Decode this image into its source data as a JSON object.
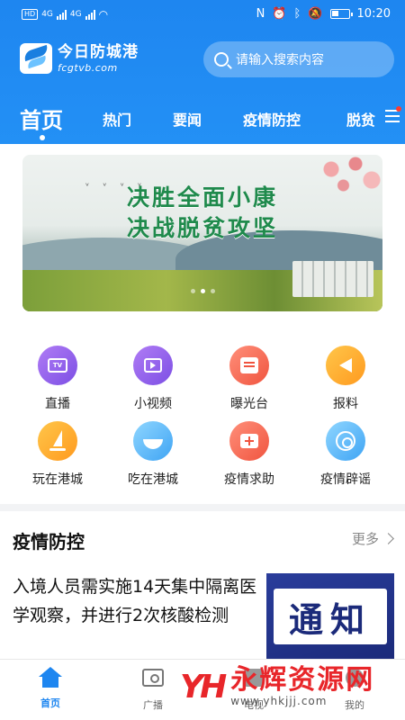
{
  "status_bar": {
    "left_badge": "HD",
    "network_a": "4G",
    "network_b": "4G",
    "time": "10:20"
  },
  "header": {
    "logo_cn": "今日防城港",
    "logo_en": "fcgtvb.com",
    "search_placeholder": "请输入搜索内容",
    "tabs": [
      {
        "label": "首页",
        "active": true
      },
      {
        "label": "热门"
      },
      {
        "label": "要闻"
      },
      {
        "label": "疫情防控"
      },
      {
        "label": "脱贫"
      }
    ]
  },
  "banner": {
    "line1": "决胜全面小康",
    "line2": "决战脱贫攻坚",
    "slide_count": 3,
    "current_slide": 2
  },
  "quick_entries": [
    {
      "label": "直播",
      "icon": "tv-icon",
      "color": "#8b5cf0"
    },
    {
      "label": "小视频",
      "icon": "video-icon",
      "color": "#8b5cf0"
    },
    {
      "label": "曝光台",
      "icon": "news-icon",
      "color": "#f0543f"
    },
    {
      "label": "报料",
      "icon": "megaphone-icon",
      "color": "#ff9a1f"
    },
    {
      "label": "玩在港城",
      "icon": "sailboat-icon",
      "color": "#ff9a1f"
    },
    {
      "label": "吃在港城",
      "icon": "bowl-icon",
      "color": "#3fa4f4"
    },
    {
      "label": "疫情求助",
      "icon": "medical-kit-icon",
      "color": "#f0543f"
    },
    {
      "label": "疫情辟谣",
      "icon": "target-icon",
      "color": "#3fa4f4"
    }
  ],
  "section": {
    "title": "疫情防控",
    "more": "更多",
    "article_title": "入境人员需实施14天集中隔离医学观察，并进行2次核酸检测",
    "thumb_text": "通知"
  },
  "bottom_nav": [
    {
      "label": "首页",
      "active": true
    },
    {
      "label": "广播"
    },
    {
      "label": "电视"
    },
    {
      "label": "我的"
    }
  ],
  "watermark": {
    "logo": "YH",
    "name": "永辉资源网",
    "url": "www.yhkjjj.com"
  },
  "colors": {
    "brand_blue": "#1e86f0",
    "accent_red": "#e8262a"
  }
}
